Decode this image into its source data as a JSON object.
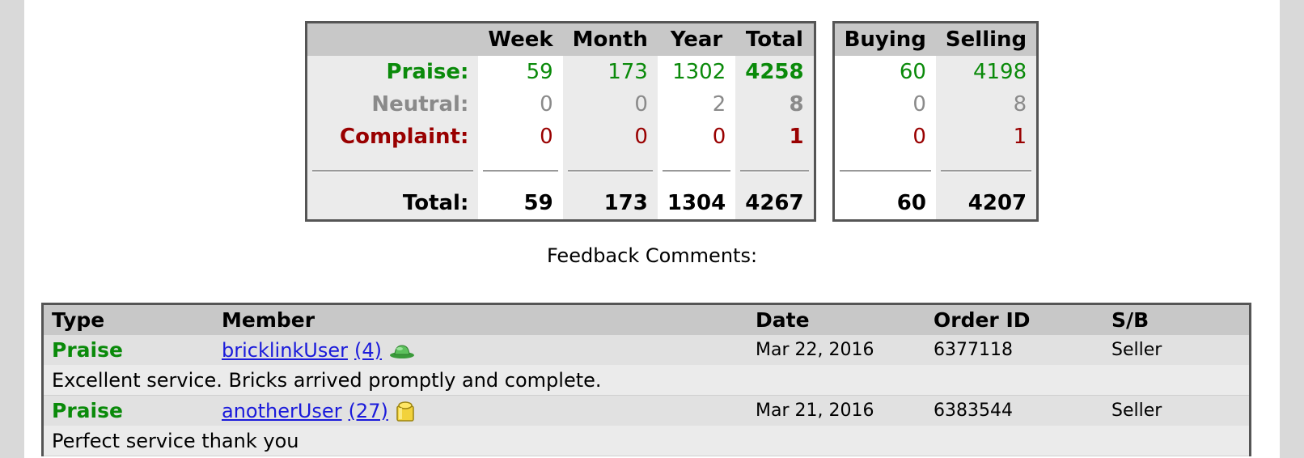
{
  "summary": {
    "headers": [
      "Week",
      "Month",
      "Year",
      "Total"
    ],
    "rows": {
      "praise": {
        "label": "Praise:",
        "week": "59",
        "month": "173",
        "year": "1302",
        "total": "4258"
      },
      "neutral": {
        "label": "Neutral:",
        "week": "0",
        "month": "0",
        "year": "2",
        "total": "8"
      },
      "complaint": {
        "label": "Complaint:",
        "week": "0",
        "month": "0",
        "year": "0",
        "total": "1"
      },
      "total": {
        "label": "Total:",
        "week": "59",
        "month": "173",
        "year": "1304",
        "total": "4267"
      }
    }
  },
  "buysell": {
    "headers": [
      "Buying",
      "Selling"
    ],
    "praise": {
      "buying": "60",
      "selling": "4198"
    },
    "neutral": {
      "buying": "0",
      "selling": "8"
    },
    "complaint": {
      "buying": "0",
      "selling": "1"
    },
    "total": {
      "buying": "60",
      "selling": "4207"
    }
  },
  "feedback_title": "Feedback Comments:",
  "comments": {
    "headers": {
      "type": "Type",
      "member": "Member",
      "date": "Date",
      "order": "Order ID",
      "sb": "S/B"
    },
    "entries": [
      {
        "type": "Praise",
        "member": "bricklinkUser",
        "count": "(4)",
        "icon": "green-hat-icon",
        "date": "Mar 22, 2016",
        "order": "6377118",
        "sb": "Seller",
        "comment": "Excellent service. Bricks arrived promptly and complete."
      },
      {
        "type": "Praise",
        "member": "anotherUser",
        "count": "(27)",
        "icon": "yellow-brick-icon",
        "date": "Mar 21, 2016",
        "order": "6383544",
        "sb": "Seller",
        "comment": "Perfect service thank you"
      }
    ]
  },
  "colors": {
    "praise": "#0a8a0a",
    "neutral": "#8a8a8a",
    "complaint": "#990000",
    "link": "#1a1adb"
  }
}
